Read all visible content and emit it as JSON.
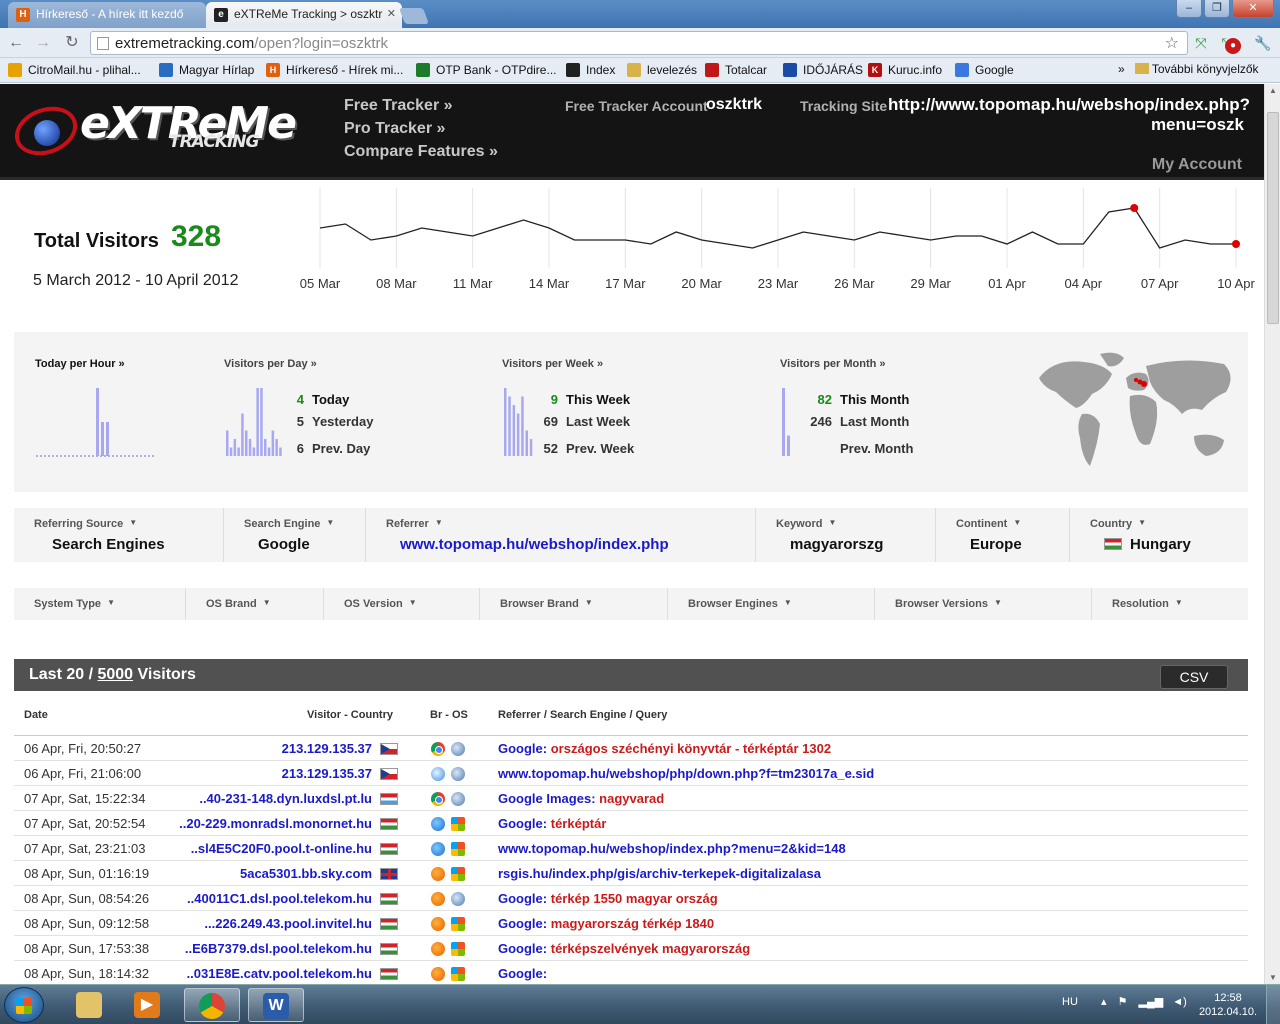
{
  "browser": {
    "tabs": [
      {
        "title": "Hírkereső - A hírek itt kezdő",
        "favicon": "H"
      },
      {
        "title": "eXTReMe Tracking > oszktr",
        "favicon": "e"
      }
    ],
    "url_host": "extremetracking.com",
    "url_path": "/open?login=oszktrk",
    "bookmarks": [
      {
        "label": "CitroMail.hu - plihal...",
        "icon": "citromail-icon",
        "color": "#e8a200"
      },
      {
        "label": "Magyar Hírlap",
        "icon": "mh-icon",
        "color": "#2a6cc4"
      },
      {
        "label": "Hírkereső - Hírek mi...",
        "icon": "H",
        "color": "#e06010"
      },
      {
        "label": "OTP Bank - OTPdire...",
        "icon": "otp-icon",
        "color": "#1f7a2a"
      },
      {
        "label": "Index",
        "icon": "index-icon",
        "color": "#222222"
      },
      {
        "label": "levelezés",
        "icon": "folder-icon",
        "color": "#d8b24a"
      },
      {
        "label": "Totalcar",
        "icon": "totalcar-icon",
        "color": "#c01818"
      },
      {
        "label": "IDŐJÁRÁS",
        "icon": "weather-icon",
        "color": "#1a4aa8"
      },
      {
        "label": "Kuruc.info",
        "icon": "K",
        "color": "#b01010"
      },
      {
        "label": "Google",
        "icon": "google-icon",
        "color": "#3a78e0"
      }
    ],
    "bookmarks_more": "További könyvjelzők"
  },
  "header": {
    "logo_text": "eXTReMe",
    "logo_sub": "TRACKING",
    "links": [
      "Free Tracker »",
      "Pro Tracker »",
      "Compare Features »"
    ],
    "account_label": "Free Tracker Account",
    "account_value": "oszktrk",
    "site_label": "Tracking Site",
    "site_value": "http://www.topomap.hu/webshop/index.php?menu=oszk",
    "my_account": "My Account"
  },
  "summary": {
    "total_label": "Total Visitors",
    "total_value": "328",
    "date_range": "5 March 2012 - 10 April 2012"
  },
  "chart_data": {
    "type": "line",
    "x_labels": [
      "05 Mar",
      "08 Mar",
      "11 Mar",
      "14 Mar",
      "17 Mar",
      "20 Mar",
      "23 Mar",
      "26 Mar",
      "29 Mar",
      "01 Apr",
      "04 Apr",
      "07 Apr",
      "10 Apr"
    ],
    "x": [
      "05 Mar",
      "06 Mar",
      "07 Mar",
      "08 Mar",
      "09 Mar",
      "10 Mar",
      "11 Mar",
      "12 Mar",
      "13 Mar",
      "14 Mar",
      "15 Mar",
      "16 Mar",
      "17 Mar",
      "18 Mar",
      "19 Mar",
      "20 Mar",
      "21 Mar",
      "22 Mar",
      "23 Mar",
      "24 Mar",
      "25 Mar",
      "26 Mar",
      "27 Mar",
      "28 Mar",
      "29 Mar",
      "30 Mar",
      "31 Mar",
      "01 Apr",
      "02 Apr",
      "03 Apr",
      "04 Apr",
      "05 Apr",
      "06 Apr",
      "07 Apr",
      "08 Apr",
      "09 Apr",
      "10 Apr"
    ],
    "values": [
      8,
      9,
      5,
      6,
      8,
      7,
      6,
      8,
      10,
      8,
      5,
      5,
      5,
      4,
      7,
      5,
      4,
      3,
      5,
      7,
      6,
      5,
      7,
      6,
      5,
      6,
      6,
      4,
      7,
      4,
      4,
      12,
      13,
      3,
      5,
      4,
      4
    ],
    "highlight": [
      32,
      36
    ],
    "ylim": [
      0,
      16
    ],
    "grid": "vertical"
  },
  "stats": {
    "today_per_hour": {
      "title": "Today per Hour »",
      "bars": [
        0,
        0,
        0,
        0,
        0,
        0,
        0,
        0,
        0,
        0,
        0,
        0,
        4,
        2,
        2,
        0,
        0,
        0,
        0,
        0,
        0,
        0,
        0,
        0
      ]
    },
    "per_day": {
      "title": "Visitors per Day »",
      "bars": [
        3,
        1,
        2,
        1,
        5,
        3,
        2,
        1,
        8,
        8,
        2,
        1,
        3,
        2,
        1
      ],
      "rows": [
        {
          "num": "4",
          "label": "Today",
          "hl": true
        },
        {
          "num": "5",
          "label": "Yesterday"
        },
        {
          "num": "6",
          "label": "Prev. Day"
        }
      ]
    },
    "per_week": {
      "title": "Visitors per Week »",
      "bars": [
        8,
        7,
        6,
        5,
        7,
        3,
        2
      ],
      "rows": [
        {
          "num": "9",
          "label": "This Week",
          "hl": true
        },
        {
          "num": "69",
          "label": "Last Week"
        },
        {
          "num": "52",
          "label": "Prev. Week"
        }
      ]
    },
    "per_month": {
      "title": "Visitors per Month »",
      "bars": [
        10,
        3
      ],
      "rows": [
        {
          "num": "82",
          "label": "This Month",
          "hl": true
        },
        {
          "num": "246",
          "label": "Last Month"
        },
        {
          "num": "",
          "label": "Prev. Month"
        }
      ]
    }
  },
  "filters": [
    {
      "label": "Referring Source",
      "value": "Search Engines"
    },
    {
      "label": "Search Engine",
      "value": "Google"
    },
    {
      "label": "Referrer",
      "value": "www.topomap.hu/webshop/index.php"
    },
    {
      "label": "Keyword",
      "value": "magyarorszg"
    },
    {
      "label": "Continent",
      "value": "Europe"
    },
    {
      "label": "Country",
      "value": "Hungary"
    }
  ],
  "filters2": [
    "System Type",
    "OS Brand",
    "OS Version",
    "Browser Brand",
    "Browser Engines",
    "Browser Versions",
    "Resolution"
  ],
  "visitors": {
    "title_pre": "Last 20 / ",
    "title_total": "5000",
    "title_post": " Visitors",
    "csv": "CSV",
    "columns": {
      "date": "Date",
      "visitor": "Visitor - Country",
      "bros": "Br - OS",
      "ref": "Referrer / Search Engine / Query"
    },
    "rows": [
      {
        "date": "06 Apr, Fri, 20:50:27",
        "host": "213.129.135.37",
        "flag": "cz",
        "br": "chrome",
        "os": "mac",
        "ref": "Google:",
        "q": "országos széchényi könyvtár - térképtár 1302"
      },
      {
        "date": "06 Apr, Fri, 21:06:00",
        "host": "213.129.135.37",
        "flag": "cz",
        "br": "safari",
        "os": "mac",
        "ref": "www.topomap.hu/webshop/php/down.php?f=tm23017a_e.sid",
        "q": ""
      },
      {
        "date": "07 Apr, Sat, 15:22:34",
        "host": "..40-231-148.dyn.luxdsl.pt.lu",
        "flag": "lu",
        "br": "chrome",
        "os": "mac",
        "ref": "Google Images:",
        "q": "nagyvarad"
      },
      {
        "date": "07 Apr, Sat, 20:52:54",
        "host": "..20-229.monradsl.monornet.hu",
        "flag": "hu",
        "br": "ie",
        "os": "win",
        "ref": "Google:",
        "q": "térképtár"
      },
      {
        "date": "07 Apr, Sat, 23:21:03",
        "host": "..sl4E5C20F0.pool.t-online.hu",
        "flag": "hu",
        "br": "ie",
        "os": "win",
        "ref": "www.topomap.hu/webshop/index.php?menu=2&kid=148",
        "q": ""
      },
      {
        "date": "08 Apr, Sun, 01:16:19",
        "host": "5aca5301.bb.sky.com",
        "flag": "gb",
        "br": "firefox",
        "os": "win",
        "ref": "rsgis.hu/index.php/gis/archiv-terkepek-digitalizalasa",
        "q": ""
      },
      {
        "date": "08 Apr, Sun, 08:54:26",
        "host": "..40011C1.dsl.pool.telekom.hu",
        "flag": "hu",
        "br": "firefox",
        "os": "mac",
        "ref": "Google:",
        "q": "térkép 1550 magyar ország"
      },
      {
        "date": "08 Apr, Sun, 09:12:58",
        "host": "...226.249.43.pool.invitel.hu",
        "flag": "hu",
        "br": "firefox",
        "os": "win",
        "ref": "Google:",
        "q": "magyarország térkép 1840"
      },
      {
        "date": "08 Apr, Sun, 17:53:38",
        "host": "..E6B7379.dsl.pool.telekom.hu",
        "flag": "hu",
        "br": "firefox",
        "os": "win",
        "ref": "Google:",
        "q": "térképszelvények magyarország"
      },
      {
        "date": "08 Apr, Sun, 18:14:32",
        "host": "..031E8E.catv.pool.telekom.hu",
        "flag": "hu",
        "br": "firefox",
        "os": "win",
        "ref": "Google:",
        "q": ""
      }
    ]
  },
  "taskbar": {
    "lang": "HU",
    "time": "12:58",
    "date": "2012.04.10."
  }
}
